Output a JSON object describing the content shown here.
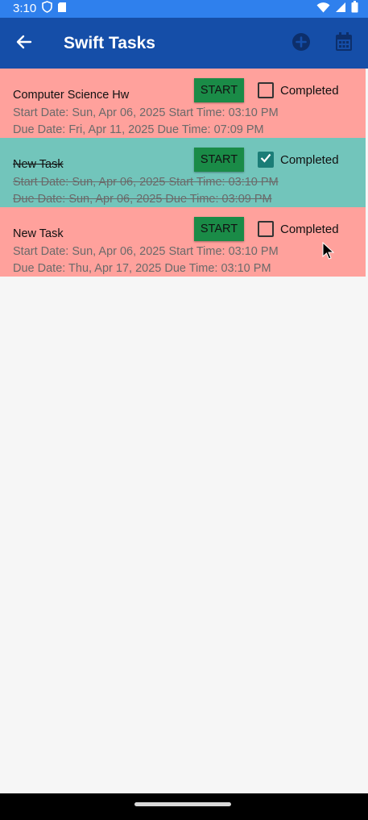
{
  "status_bar": {
    "time": "3:10",
    "icons": [
      "shield-icon",
      "sd-card-icon",
      "wifi-icon",
      "signal-icon",
      "battery-icon"
    ]
  },
  "app_bar": {
    "title": "Swift Tasks",
    "icons": [
      "back-arrow-icon",
      "add-circle-icon",
      "calendar-icon"
    ]
  },
  "tasks": [
    {
      "title": "Computer Science Hw",
      "start_line": "Start Date: Sun, Apr 06, 2025 Start Time: 03:10 PM",
      "due_line": "Due Date: Fri, Apr 11, 2025 Due Time: 07:09 PM",
      "start_button_label": "START",
      "completed_label": "Completed",
      "completed": false
    },
    {
      "title": "New Task",
      "start_line": "Start Date: Sun, Apr 06, 2025 Start Time: 03:10 PM",
      "due_line": "Due Date: Sun, Apr 06, 2025 Due Time: 03:09 PM",
      "start_button_label": "START",
      "completed_label": "Completed",
      "completed": true
    },
    {
      "title": "New Task",
      "start_line": "Start Date: Sun, Apr 06, 2025 Start Time: 03:10 PM",
      "due_line": "Due Date: Thu, Apr 17, 2025 Due Time: 03:10 PM",
      "start_button_label": "START",
      "completed_label": "Completed",
      "completed": false
    }
  ],
  "colors": {
    "status_bar": "#2f80ed",
    "app_bar": "#154ea8",
    "task_pending": "#ffa19c",
    "task_completed": "#72c5bb",
    "start_button": "#1a8b47",
    "checkbox_checked": "#1b7d77",
    "background": "#f6f6f6"
  }
}
